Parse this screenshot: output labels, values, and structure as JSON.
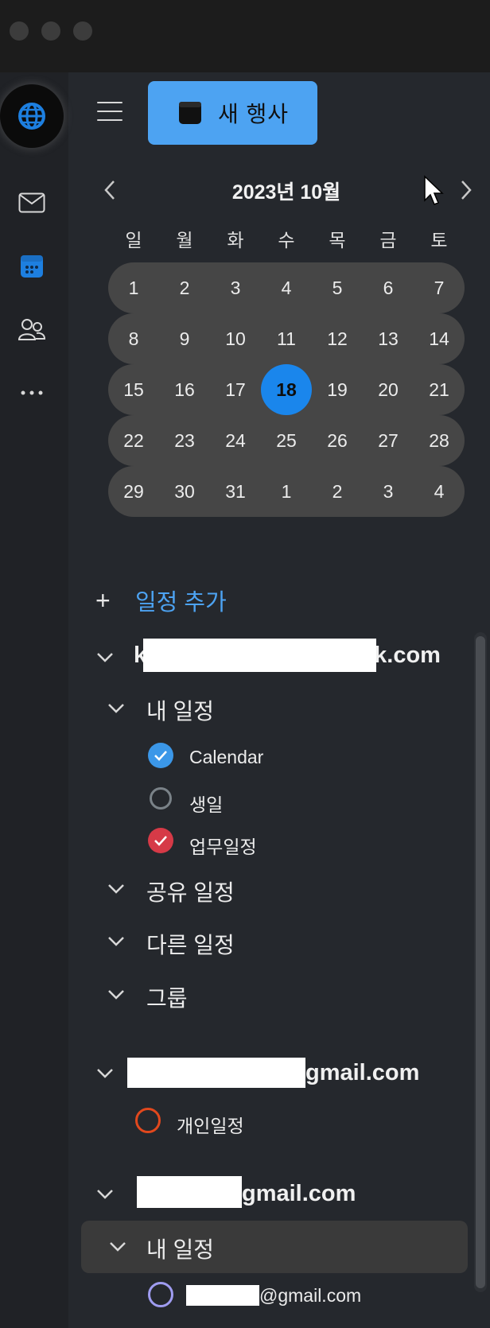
{
  "toolbar": {
    "new_event_label": "새 행사"
  },
  "calendar": {
    "month_title": "2023년 10월",
    "weekdays": [
      "일",
      "월",
      "화",
      "수",
      "목",
      "금",
      "토"
    ],
    "weeks": [
      [
        "1",
        "2",
        "3",
        "4",
        "5",
        "6",
        "7"
      ],
      [
        "8",
        "9",
        "10",
        "11",
        "12",
        "13",
        "14"
      ],
      [
        "15",
        "16",
        "17",
        "18",
        "19",
        "20",
        "21"
      ],
      [
        "22",
        "23",
        "24",
        "25",
        "26",
        "27",
        "28"
      ],
      [
        "29",
        "30",
        "31",
        "1",
        "2",
        "3",
        "4"
      ]
    ],
    "today": "18"
  },
  "add_event_label": "일정 추가",
  "accounts": [
    {
      "email_prefix": "k",
      "email_suffix": "k.com",
      "groups": [
        {
          "label": "내 일정",
          "calendars": [
            {
              "name": "Calendar",
              "state": "checked",
              "color": "#3b97e8"
            },
            {
              "name": "생일",
              "state": "unchecked",
              "color": "#7a8288"
            },
            {
              "name": "업무일정",
              "state": "checked",
              "color": "#d63a47"
            }
          ]
        },
        {
          "label": "공유 일정"
        },
        {
          "label": "다른 일정"
        },
        {
          "label": "그룹"
        }
      ]
    },
    {
      "email_suffix": "gmail.com",
      "calendars": [
        {
          "name": "개인일정",
          "state": "unchecked",
          "color": "#e2481d"
        }
      ]
    },
    {
      "email_suffix": "gmail.com",
      "groups": [
        {
          "label": "내 일정",
          "calendars": [
            {
              "name": "@gmail.com",
              "state": "unchecked",
              "color": "#9f9cf0"
            }
          ]
        }
      ]
    }
  ]
}
